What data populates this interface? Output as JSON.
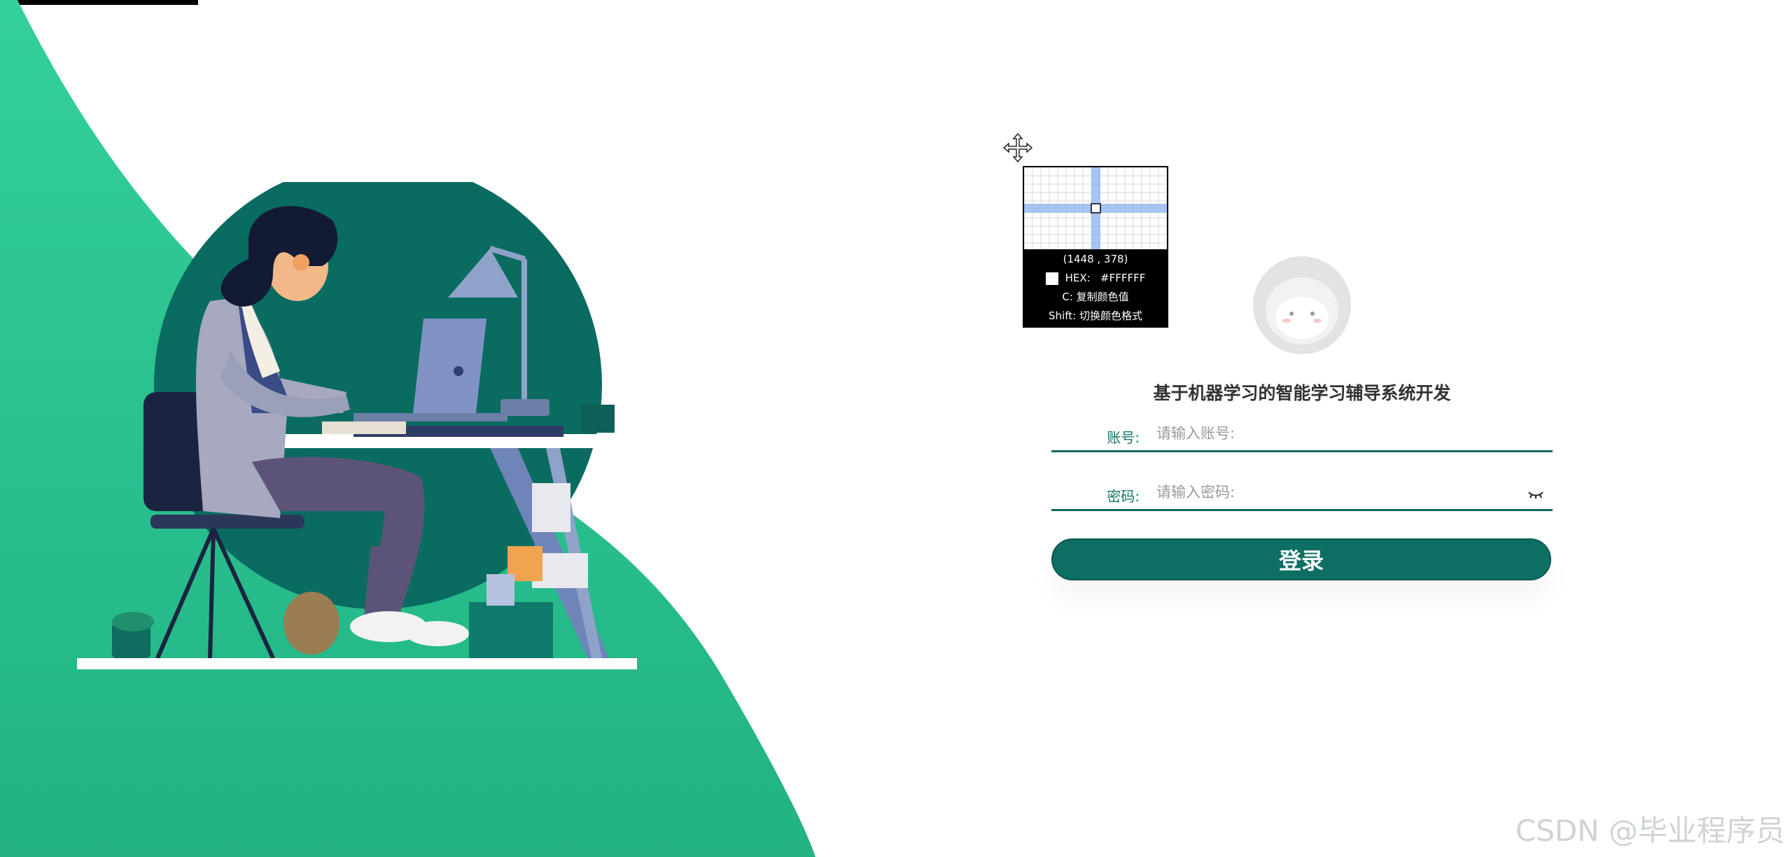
{
  "app": {
    "title": "基于机器学习的智能学习辅导系统开发"
  },
  "login": {
    "account_label": "账号:",
    "account_placeholder": "请输入账号:",
    "password_label": "密码:",
    "password_placeholder": "请输入密码:",
    "submit_label": "登录"
  },
  "color_picker": {
    "coords": "(1448 , 378)",
    "hex_label": "HEX:",
    "hex_value": "#FFFFFF",
    "copy_hint": "C: 复制颜色值",
    "shift_hint": "Shift: 切换颜色格式"
  },
  "watermark": "CSDN @毕业程序员",
  "colors": {
    "brand_green": "#2ecc8f",
    "dark_teal": "#0d6e64",
    "label_teal": "#13756a"
  },
  "icons": [
    "move-cursor-icon",
    "eye-closed-icon",
    "avatar-icon"
  ]
}
